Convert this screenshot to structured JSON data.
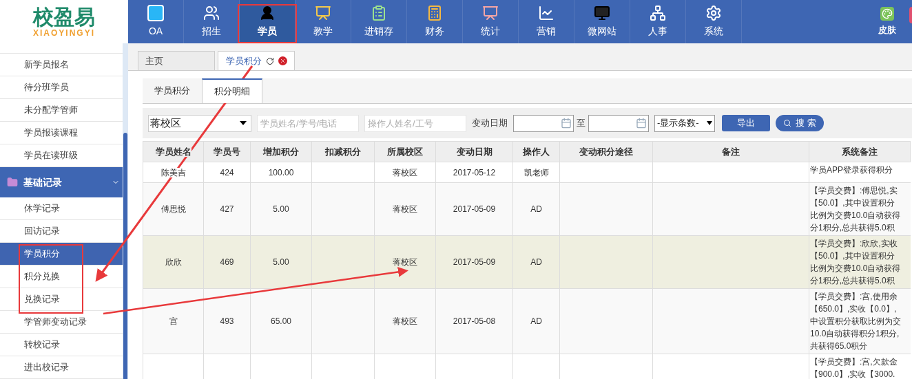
{
  "logo": {
    "name": "校盈易",
    "subtitle": "XIAOYINGYI"
  },
  "nav": [
    {
      "label": "OA",
      "selected": false
    },
    {
      "label": "招生",
      "selected": false
    },
    {
      "label": "学员",
      "selected": true
    },
    {
      "label": "教学",
      "selected": false
    },
    {
      "label": "进销存",
      "selected": false
    },
    {
      "label": "财务",
      "selected": false
    },
    {
      "label": "统计",
      "selected": false
    },
    {
      "label": "营销",
      "selected": false
    },
    {
      "label": "微网站",
      "selected": false
    },
    {
      "label": "人事",
      "selected": false
    },
    {
      "label": "系统",
      "selected": false
    }
  ],
  "nav_right": [
    {
      "label": "皮肤"
    }
  ],
  "sidebar": {
    "items_top": [
      {
        "label": "新学员报名",
        "selected": false
      },
      {
        "label": "待分班学员",
        "selected": false
      },
      {
        "label": "未分配学管师",
        "selected": false
      },
      {
        "label": "学员报读课程",
        "selected": false
      },
      {
        "label": "学员在读班级",
        "selected": false
      }
    ],
    "section": {
      "label": "基础记录",
      "expanded": true
    },
    "items": [
      {
        "label": "休学记录",
        "selected": false
      },
      {
        "label": "回访记录",
        "selected": false
      },
      {
        "label": "学员积分",
        "selected": true
      },
      {
        "label": "积分兑换",
        "selected": false
      },
      {
        "label": "兑换记录",
        "selected": false
      },
      {
        "label": "学管师变动记录",
        "selected": false
      },
      {
        "label": "转校记录",
        "selected": false
      },
      {
        "label": "进出校记录",
        "selected": false
      }
    ]
  },
  "page_tabs": [
    {
      "label": "主页",
      "selected": false,
      "closable": false
    },
    {
      "label": "学员积分",
      "selected": true,
      "closable": true
    }
  ],
  "sub_tabs": [
    {
      "label": "学员积分",
      "selected": false
    },
    {
      "label": "积分明细",
      "selected": true
    }
  ],
  "filters": {
    "campus": "蒋校区",
    "student_placeholder": "学员姓名/学号/电话",
    "operator_placeholder": "操作人姓名/工号",
    "date_label": "变动日期",
    "to_label": "至",
    "page_size": "-显示条数-",
    "export": "导出",
    "search": "搜 索"
  },
  "table": {
    "columns": [
      "学员姓名",
      "学员号",
      "增加积分",
      "扣减积分",
      "所属校区",
      "变动日期",
      "操作人",
      "变动积分途径",
      "备注",
      "系统备注"
    ],
    "rows": [
      {
        "selected": false,
        "cells": [
          "陈美吉",
          "424",
          "100.00",
          "",
          "蒋校区",
          "2017-05-12",
          "凯老师",
          "",
          ""
        ],
        "system_note": [
          "学员APP登录获得积分"
        ]
      },
      {
        "selected": false,
        "cells": [
          "傅思悦",
          "427",
          "5.00",
          "",
          "蒋校区",
          "2017-05-09",
          "AD",
          "",
          ""
        ],
        "system_note": [
          "【学员交费】:傅思悦,实",
          "【50.0】,其中设置积分",
          "比例为交费10.0自动获得",
          "分1积分,总共获得5.0积"
        ]
      },
      {
        "selected": true,
        "cells": [
          "欣欣",
          "469",
          "5.00",
          "",
          "蒋校区",
          "2017-05-09",
          "AD",
          "",
          ""
        ],
        "system_note": [
          "【学员交费】:欣欣,实收",
          "【50.0】,其中设置积分",
          "比例为交费10.0自动获得",
          "分1积分,总共获得5.0积"
        ]
      },
      {
        "selected": false,
        "cells": [
          "宫",
          "493",
          "65.00",
          "",
          "蒋校区",
          "2017-05-08",
          "AD",
          "",
          ""
        ],
        "system_note": [
          "【学员交费】:宫,使用余",
          "【650.0】,实收【0.0】,",
          "中设置积分获取比例为交",
          "10.0自动获得积分1积分,",
          "共获得65.0积分"
        ]
      },
      {
        "selected": false,
        "cells": [
          "",
          "",
          "",
          "",
          "",
          "",
          "",
          "",
          ""
        ],
        "system_note": [
          "【学员交费】:宫,欠款金",
          "【900.0】,实收【3000."
        ]
      }
    ]
  }
}
